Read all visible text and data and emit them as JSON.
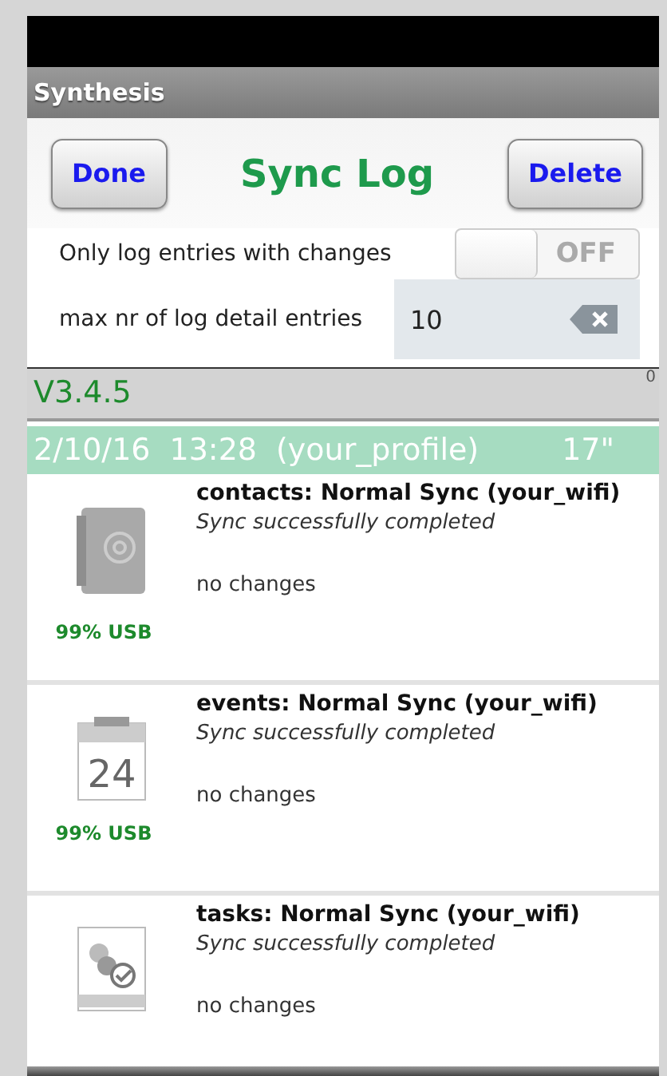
{
  "app_bar": {
    "title": "Synthesis"
  },
  "header": {
    "done_button": "Done",
    "title": "Sync Log",
    "delete_button": "Delete"
  },
  "settings": {
    "toggle_label": "Only log entries with changes",
    "toggle_on": false,
    "toggle_text": "OFF",
    "field_label": "max nr of log detail entries",
    "field_value": "10"
  },
  "version_bar": {
    "version": "V3.4.5",
    "marker": "0"
  },
  "session": {
    "date": "2/10/16",
    "time": "13:28",
    "profile": "(your_profile)",
    "duration": "17\""
  },
  "entries": [
    {
      "kind": "contacts",
      "title": "contacts: Normal Sync  (your_wifi)",
      "status": "Sync successfully completed",
      "detail": "no changes",
      "battery": "99% USB"
    },
    {
      "kind": "events",
      "icon_label": "24",
      "title": "events: Normal Sync  (your_wifi)",
      "status": "Sync successfully completed",
      "detail": "no changes",
      "battery": "99% USB"
    },
    {
      "kind": "tasks",
      "title": "tasks: Normal Sync  (your_wifi)",
      "status": "Sync successfully completed",
      "detail": "no changes"
    }
  ]
}
